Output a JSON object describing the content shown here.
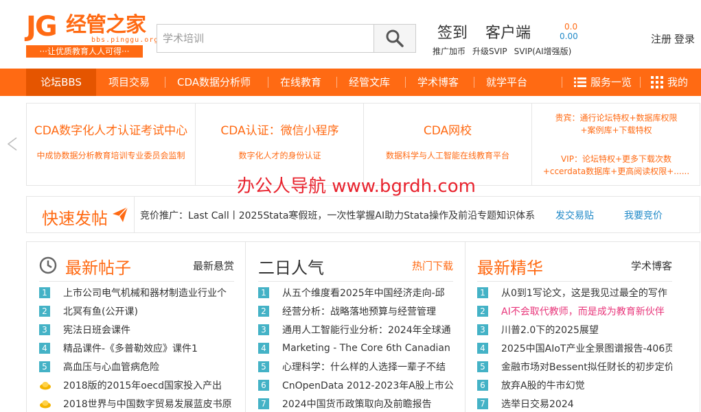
{
  "header": {
    "logo_jg": "JG",
    "logo_cn": "经管之家",
    "logo_domain": "bbs.pinggu.org",
    "logo_slogan": "···让优质教育人人可得···",
    "search_placeholder": "学术培训",
    "signin": "签到",
    "client": "客户端",
    "balance_top": "0.0",
    "balance_bottom": "0.00",
    "sub_links": [
      "推广加币",
      "升级SVIP",
      "SVIP(AI增强版)"
    ],
    "register": "注册",
    "login": "登录"
  },
  "nav": {
    "items": [
      "论坛BBS",
      "项目交易",
      "CDA数据分析师",
      "在线教育",
      "经管文库",
      "学术博客",
      "就学平台"
    ],
    "services": "服务一览",
    "mine": "我的"
  },
  "banner": {
    "cells": [
      {
        "title": "CDA数字化人才认证考试中心",
        "subtitle": "中成协数据分析教育培训专业委员会监制"
      },
      {
        "title": "CDA认证：微信小程序",
        "subtitle": "数字化人才的身份认证"
      },
      {
        "title": "CDA网校",
        "subtitle": "数据科学与人工智能在线教育平台"
      }
    ],
    "vip_guest_line1": "贵宾：通行论坛特权+数据库权限",
    "vip_guest_line2": "+案例库+下载特权",
    "vip_line1": "VIP：论坛特权+更多下载次数",
    "vip_line2": "+ccerdata数据库+更高阅读权限+......"
  },
  "watermark": "办公人导航  www.bgrdh.com",
  "quick": {
    "title": "快速发帖",
    "promo": "竞价推广：Last Call丨2025Stata寒假班，一次性掌握AI助力Stata操作及前沿专题知识体系",
    "link1": "发交易贴",
    "link2": "我要竞价"
  },
  "columns": [
    {
      "title": "最新帖子",
      "more": "最新悬赏",
      "rows": [
        {
          "rank": "1",
          "text": "上市公司电气机械和器材制造业行业个"
        },
        {
          "rank": "2",
          "text": "北冥有鱼(公开课)"
        },
        {
          "rank": "3",
          "text": "宪法日班会课件"
        },
        {
          "rank": "4",
          "text": "精品课件-《多普勒效应》课件1"
        },
        {
          "rank": "5",
          "text": "高血压与心血管病危险"
        },
        {
          "rank": "",
          "text": "2018版的2015年oecd国家投入产出"
        },
        {
          "rank": "",
          "text": "2018世界与中国数字贸易发展蓝皮书原"
        }
      ]
    },
    {
      "title": "二日人气",
      "more": "热门下载",
      "rows": [
        {
          "rank": "1",
          "text": "从五个维度看2025年中国经济走向-邱"
        },
        {
          "rank": "2",
          "text": "经营分析：战略落地预算与经营管理"
        },
        {
          "rank": "3",
          "text": "通用人工智能行业分析：2024年全球通"
        },
        {
          "rank": "4",
          "text": "Marketing - The Core 6th Canadian"
        },
        {
          "rank": "5",
          "text": "心理科学：什么样的人选择一辈子不结"
        },
        {
          "rank": "6",
          "text": "CnOpenData 2012-2023年A股上市公"
        },
        {
          "rank": "7",
          "text": "2024中国货币政策取向及前瞻报告"
        }
      ]
    },
    {
      "title": "最新精华",
      "more": "学术博客",
      "rows": [
        {
          "rank": "1",
          "text": "从0到1写论文，这是我见过最全的写作"
        },
        {
          "rank": "2",
          "text": "AI不会取代教师，而是成为教育新伙伴"
        },
        {
          "rank": "3",
          "text": "川普2.0下的2025展望"
        },
        {
          "rank": "4",
          "text": "2025中国AIoT产业全景图谱报告-406页"
        },
        {
          "rank": "5",
          "text": "金融市场对Bessent拟任财长的初步定价"
        },
        {
          "rank": "6",
          "text": "放弃A股的牛市幻觉"
        },
        {
          "rank": "7",
          "text": "选举日交易2024"
        }
      ]
    }
  ],
  "colors": {
    "accent": "#ff6a13",
    "badge": "#44b2c6",
    "link": "#1e88c7",
    "watermark": "#e8222d"
  }
}
